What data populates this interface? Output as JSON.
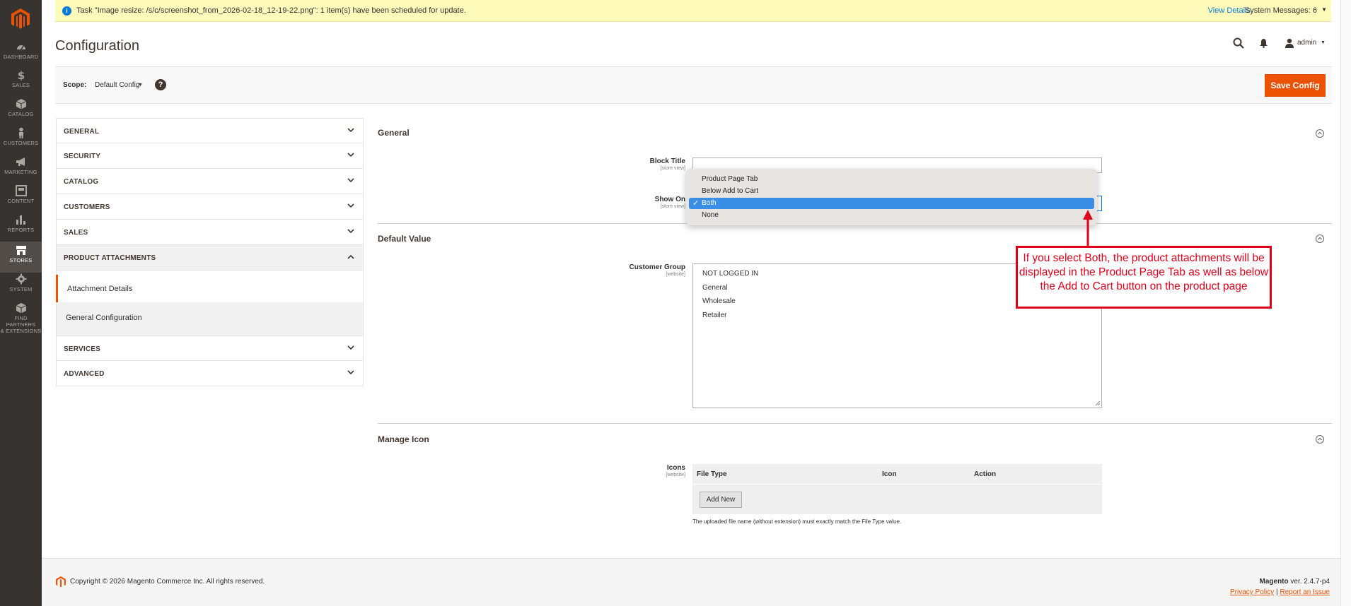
{
  "notice": {
    "message": "Task \"Image resize: /s/c/screenshot_from_2026-02-18_12-19-22.png\": 1 item(s) have been scheduled for update.",
    "view_details": "View Details",
    "system_messages": "System Messages: 6"
  },
  "nav": {
    "items": [
      {
        "label": "DASHBOARD",
        "icon": "dashboard-icon"
      },
      {
        "label": "SALES",
        "icon": "dollar-icon"
      },
      {
        "label": "CATALOG",
        "icon": "box-icon"
      },
      {
        "label": "CUSTOMERS",
        "icon": "person-icon"
      },
      {
        "label": "MARKETING",
        "icon": "megaphone-icon"
      },
      {
        "label": "CONTENT",
        "icon": "layout-icon"
      },
      {
        "label": "REPORTS",
        "icon": "bar-chart-icon"
      },
      {
        "label": "STORES",
        "icon": "storefront-icon"
      },
      {
        "label": "SYSTEM",
        "icon": "gear-icon"
      },
      {
        "label": "FIND PARTNERS",
        "label2": "& EXTENSIONS",
        "icon": "cube-icon"
      }
    ],
    "active": "STORES"
  },
  "header": {
    "title": "Configuration",
    "user": "admin"
  },
  "scope": {
    "label": "Scope:",
    "value": "Default Config",
    "help": "?",
    "save_label": "Save Config"
  },
  "tabs": {
    "general": "GENERAL",
    "security": "SECURITY",
    "catalog": "CATALOG",
    "customers": "CUSTOMERS",
    "sales": "SALES",
    "product_attachments": "PRODUCT ATTACHMENTS",
    "attachment_details": "Attachment Details",
    "general_configuration": "General Configuration",
    "services": "SERVICES",
    "advanced": "ADVANCED"
  },
  "general_section": {
    "title": "General",
    "block_title_label": "Block Title",
    "block_title_scope": "[store view]",
    "block_title_value": "",
    "show_on_label": "Show On",
    "show_on_scope": "[store view]",
    "show_on_options": [
      "Product Page Tab",
      "Below Add to Cart",
      "Both",
      "None"
    ],
    "show_on_selected": "Both",
    "check": "✓"
  },
  "default_value_section": {
    "title": "Default Value",
    "customer_group_label": "Customer Group",
    "customer_group_scope": "[website]",
    "groups": [
      "NOT LOGGED IN",
      "General",
      "Wholesale",
      "Retailer"
    ]
  },
  "annotation": {
    "text": "If you select Both, the product attachments will be displayed in the Product Page Tab as well as below the Add to Cart button on the product page"
  },
  "manage_icon_section": {
    "title": "Manage Icon",
    "icons_label": "Icons",
    "icons_scope": "[website]",
    "columns": [
      "File Type",
      "Icon",
      "Action"
    ],
    "add_new": "Add New",
    "note": "The uploaded file name (without extension) must exactly match the File Type value."
  },
  "footer": {
    "copyright": "Copyright © 2026 Magento Commerce Inc. All rights reserved.",
    "brand": "Magento",
    "version": " ver. 2.4.7-p4",
    "privacy": "Privacy Policy",
    "separator": "|",
    "report": "Report an Issue"
  },
  "colors": {
    "accent": "#eb5202",
    "sidebar": "#373330",
    "annotation": "#e0001b",
    "selected": "#3a8ee6"
  }
}
